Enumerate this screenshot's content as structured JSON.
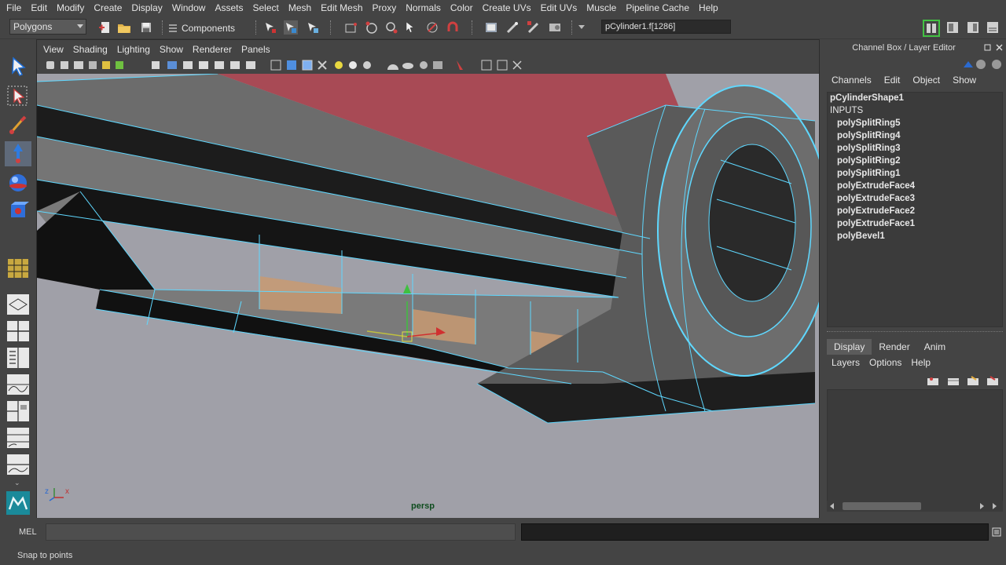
{
  "menubar": [
    "File",
    "Edit",
    "Modify",
    "Create",
    "Display",
    "Window",
    "Assets",
    "Select",
    "Mesh",
    "Edit Mesh",
    "Proxy",
    "Normals",
    "Color",
    "Create UVs",
    "Edit UVs",
    "Muscle",
    "Pipeline Cache",
    "Help"
  ],
  "statusline": {
    "mode_menu": "Polygons",
    "selection_mode": "Components",
    "selection_field": "pCylinder1.f[1286]"
  },
  "viewport": {
    "menu": [
      "View",
      "Shading",
      "Lighting",
      "Show",
      "Renderer",
      "Panels"
    ],
    "camera": "persp",
    "axis_x": "x",
    "axis_z": "z"
  },
  "channel_box": {
    "title": "Channel Box / Layer Editor",
    "menu": [
      "Channels",
      "Edit",
      "Object",
      "Show"
    ],
    "object": "pCylinderShape1",
    "inputs_label": "INPUTS",
    "inputs": [
      "polySplitRing5",
      "polySplitRing4",
      "polySplitRing3",
      "polySplitRing2",
      "polySplitRing1",
      "polyExtrudeFace4",
      "polyExtrudeFace3",
      "polyExtrudeFace2",
      "polyExtrudeFace1",
      "polyBevel1"
    ]
  },
  "layer_editor": {
    "tabs": [
      "Display",
      "Render",
      "Anim"
    ],
    "active_tab": "Display",
    "menu": [
      "Layers",
      "Options",
      "Help"
    ]
  },
  "command_line": {
    "label": "MEL"
  },
  "help_line": {
    "text": "Snap to points"
  },
  "colors": {
    "ui_bg": "#444444",
    "viewport_bg": "#a0a0a8",
    "wire": "#5fd8ff",
    "face_selected": "#c89a72",
    "red_face": "#a84a55"
  }
}
